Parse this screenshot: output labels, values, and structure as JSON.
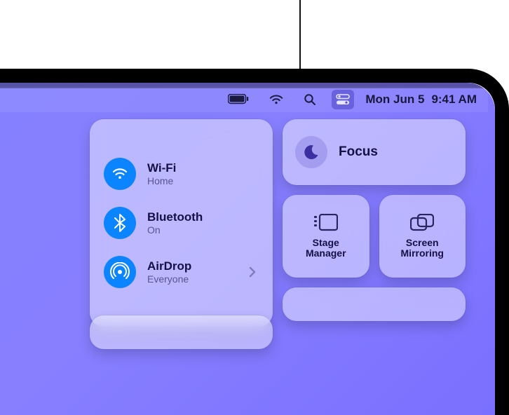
{
  "menubar": {
    "battery_pct": null,
    "date_label": "Mon Jun 5",
    "time_label": "9:41 AM"
  },
  "control_center": {
    "connectivity": {
      "wifi": {
        "label": "Wi-Fi",
        "status": "Home"
      },
      "bluetooth": {
        "label": "Bluetooth",
        "status": "On"
      },
      "airdrop": {
        "label": "AirDrop",
        "status": "Everyone"
      }
    },
    "focus": {
      "label": "Focus"
    },
    "stage_manager": {
      "label": "Stage Manager"
    },
    "screen_mirroring": {
      "label": "Screen Mirroring"
    }
  },
  "colors": {
    "accent_blue": "#0a84ff",
    "wallpaper": "#877fff"
  }
}
